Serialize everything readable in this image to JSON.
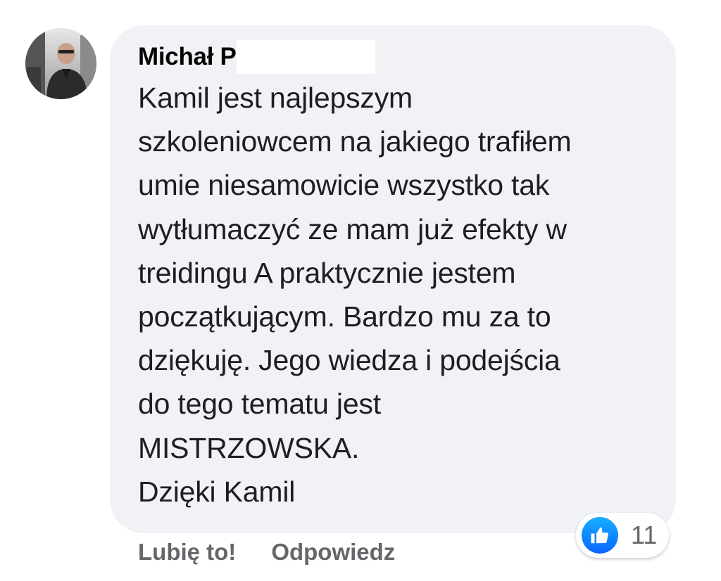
{
  "comment": {
    "author": {
      "name": "Michał P",
      "avatar_icon": "person-in-car-avatar"
    },
    "text_lines": [
      "Kamil jest najlepszym",
      "szkoleniowcem na jakiego trafiłem",
      "umie niesamowicie wszystko tak",
      "wytłumaczyć ze mam już efekty w",
      "treidingu A praktycznie jestem",
      "początkującym. Bardzo mu za to",
      "dziękuję. Jego wiedza i podejścia",
      "do tego tematu jest",
      "MISTRZOWSKA.",
      "Dzięki Kamil"
    ],
    "actions": {
      "like_label": "Lubię to!",
      "reply_label": "Odpowiedz"
    },
    "reactions": {
      "icon": "like-thumbs-up-icon",
      "count": "11"
    }
  },
  "colors": {
    "bubble_background": "#f0f2f5",
    "like_blue": "#0866ff",
    "secondary_text": "#65676b"
  }
}
